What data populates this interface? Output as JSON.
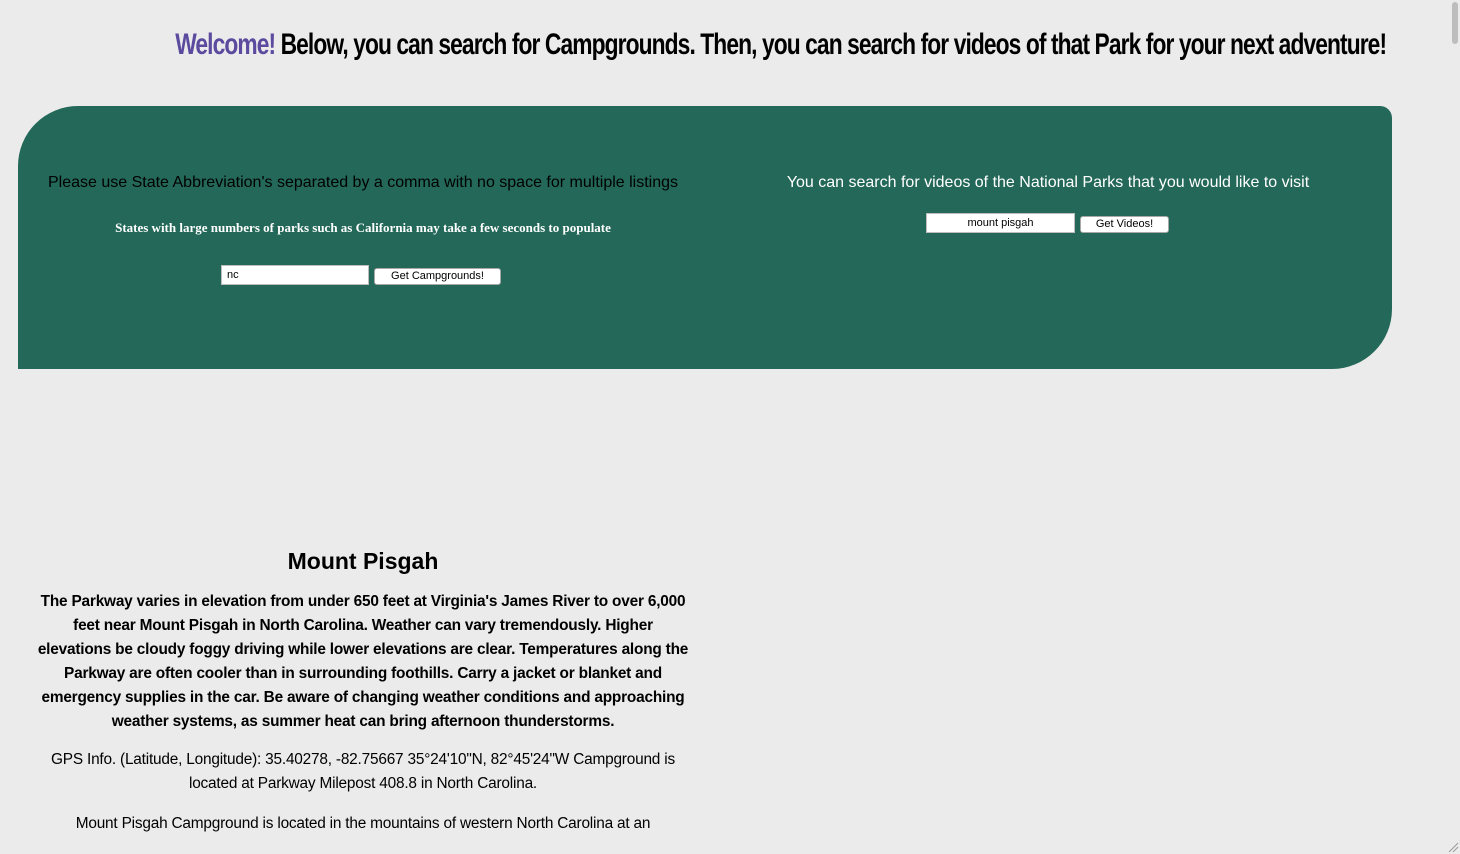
{
  "header": {
    "welcome": "Welcome!",
    "text": " Below, you can search for Campgrounds. Then, you can search for videos of that Park for your next adventure!"
  },
  "campground_search": {
    "instruction": "Please use State Abbreviation's separated by a comma with no space for multiple listings",
    "note": "States with large numbers of parks such as California may take a few seconds to populate",
    "input_value": "nc",
    "button_label": "Get Campgrounds!"
  },
  "video_search": {
    "instruction": "You can search for videos of the National Parks that you would like to visit",
    "input_value": "mount pisgah",
    "button_label": "Get Videos!"
  },
  "result": {
    "title": "Mount Pisgah",
    "description": "The Parkway varies in elevation from under 650 feet at Virginia's James River to over 6,000 feet near Mount Pisgah in North Carolina. Weather can vary tremendously. Higher elevations be cloudy foggy driving while lower elevations are clear. Temperatures along the Parkway are often cooler than in surrounding foothills. Carry a jacket or blanket and emergency supplies in the car. Be aware of changing weather conditions and approaching weather systems, as summer heat can bring afternoon thunderstorms.",
    "gps": "GPS Info. (Latitude, Longitude): 35.40278, -82.75667 35°24'10\"N, 82°45'24\"W Campground is located at Parkway Milepost 408.8 in North Carolina.",
    "about": "Mount Pisgah Campground is located in the mountains of western North Carolina at an"
  },
  "colors": {
    "panel": "#236858",
    "welcome": "#5b4a9e",
    "background": "#ebebeb"
  }
}
